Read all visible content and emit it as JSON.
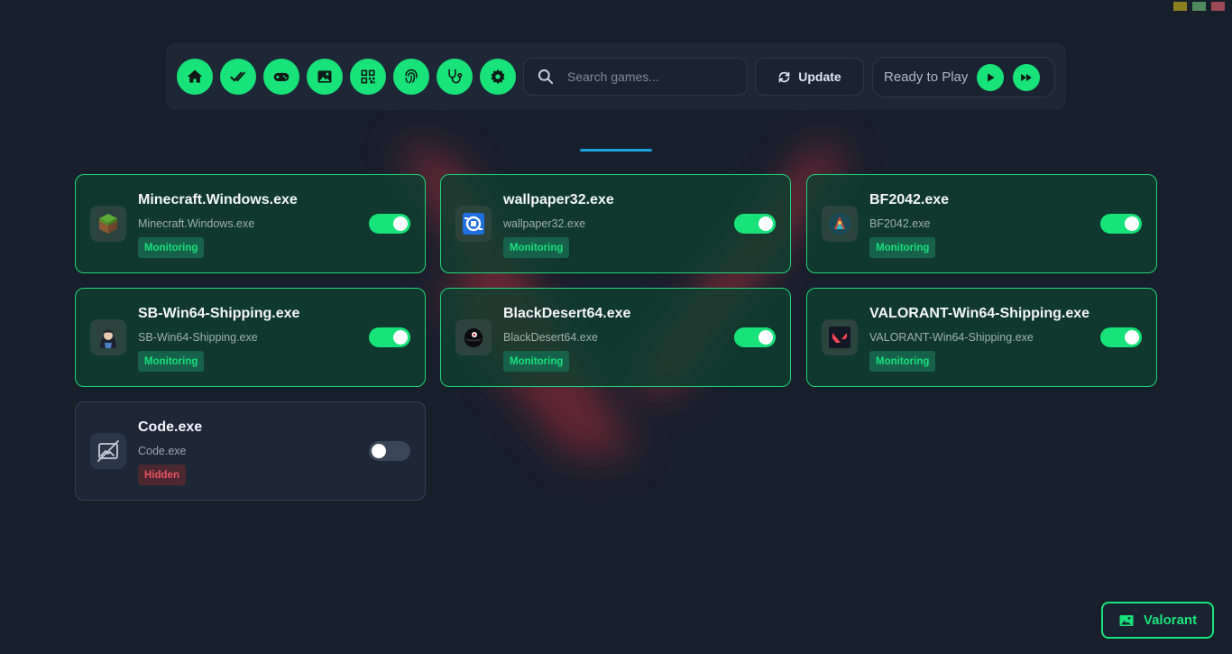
{
  "toolbar": {
    "nav": [
      {
        "name": "home-icon",
        "label": "Home"
      },
      {
        "name": "double-check-icon",
        "label": "Checked"
      },
      {
        "name": "gamepad-icon",
        "label": "Games"
      },
      {
        "name": "image-icon",
        "label": "Images"
      },
      {
        "name": "qr-code-icon",
        "label": "QR"
      },
      {
        "name": "fingerprint-icon",
        "label": "Fingerprint"
      },
      {
        "name": "stethoscope-icon",
        "label": "Diagnostics"
      },
      {
        "name": "gear-icon",
        "label": "Settings"
      }
    ],
    "search_placeholder": "Search games...",
    "update_label": "Update",
    "ready_label": "Ready to Play"
  },
  "cards": [
    {
      "title": "Minecraft.Windows.exe",
      "subtitle": "Minecraft.Windows.exe",
      "status": "Monitoring",
      "enabled": true,
      "icon": "minecraft-icon"
    },
    {
      "title": "wallpaper32.exe",
      "subtitle": "wallpaper32.exe",
      "status": "Monitoring",
      "enabled": true,
      "icon": "wallpaper-engine-icon"
    },
    {
      "title": "BF2042.exe",
      "subtitle": "BF2042.exe",
      "status": "Monitoring",
      "enabled": true,
      "icon": "bf2042-icon"
    },
    {
      "title": "SB-Win64-Shipping.exe",
      "subtitle": "SB-Win64-Shipping.exe",
      "status": "Monitoring",
      "enabled": true,
      "icon": "stellar-blade-icon"
    },
    {
      "title": "BlackDesert64.exe",
      "subtitle": "BlackDesert64.exe",
      "status": "Monitoring",
      "enabled": true,
      "icon": "black-desert-icon"
    },
    {
      "title": "VALORANT-Win64-Shipping.exe",
      "subtitle": "VALORANT-Win64-Shipping.exe",
      "status": "Monitoring",
      "enabled": true,
      "icon": "valorant-icon"
    },
    {
      "title": "Code.exe",
      "subtitle": "Code.exe",
      "status": "Hidden",
      "enabled": false,
      "icon": "no-image-icon"
    }
  ],
  "float_button": {
    "label": "Valorant"
  },
  "colors": {
    "accent": "#18e37a",
    "background": "#171f2b",
    "hidden": "#e6545e",
    "divider": "#19a3d9"
  }
}
